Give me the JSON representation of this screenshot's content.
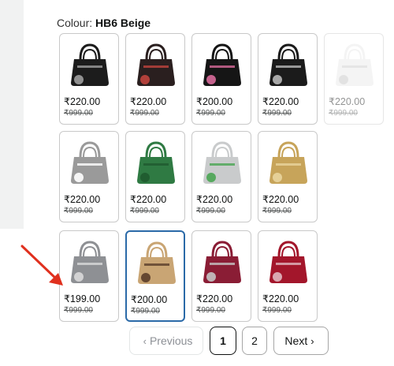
{
  "colour": {
    "label": "Colour:",
    "value": "HB6 Beige"
  },
  "swatches": [
    {
      "price": "₹220.00",
      "mrp": "₹999.00",
      "color": "#1c1c1c",
      "accent": "#9e9e9e"
    },
    {
      "price": "₹220.00",
      "mrp": "₹999.00",
      "color": "#2a1f1f",
      "accent": "#c0443d"
    },
    {
      "price": "₹200.00",
      "mrp": "₹999.00",
      "color": "#151515",
      "accent": "#d86a9a"
    },
    {
      "price": "₹220.00",
      "mrp": "₹999.00",
      "color": "#1b1b1b",
      "accent": "#b8b8b8"
    },
    {
      "price": "₹220.00",
      "mrp": "₹999.00",
      "color": "#e8e8e8",
      "accent": "#bdbdbd"
    },
    {
      "price": "₹220.00",
      "mrp": "₹999.00",
      "color": "#9a9a9a",
      "accent": "#ffffff"
    },
    {
      "price": "₹220.00",
      "mrp": "₹999.00",
      "color": "#2f7a43",
      "accent": "#1f5a2f"
    },
    {
      "price": "₹220.00",
      "mrp": "₹999.00",
      "color": "#c9cbcc",
      "accent": "#4aa553"
    },
    {
      "price": "₹220.00",
      "mrp": "₹999.00",
      "color": "#c7a45a",
      "accent": "#e9d59d"
    },
    {
      "price": "₹199.00",
      "mrp": "₹999.00",
      "color": "#8e9094",
      "accent": "#d9d9d9"
    },
    {
      "price": "₹200.00",
      "mrp": "₹999.00",
      "color": "#c9a574",
      "accent": "#5a3d2a"
    },
    {
      "price": "₹220.00",
      "mrp": "₹999.00",
      "color": "#8a1d35",
      "accent": "#c4c4c4"
    },
    {
      "price": "₹220.00",
      "mrp": "₹999.00",
      "color": "#a3162b",
      "accent": "#e0b8c0"
    }
  ],
  "pagination": {
    "previous": "Previous",
    "page1": "1",
    "page2": "2",
    "next": "Next"
  },
  "icons": {
    "prev": "chevron-left-icon",
    "next": "chevron-right-icon",
    "annotation": "red-arrow-icon"
  },
  "colors": {
    "selected_border": "#2b6aa8",
    "arrow": "#e0301e"
  }
}
